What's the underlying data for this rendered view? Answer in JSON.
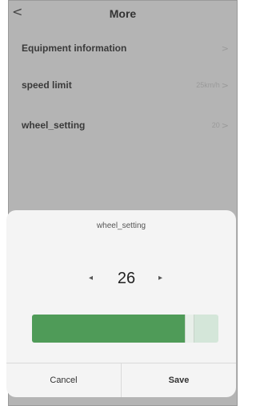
{
  "header": {
    "back_glyph": "<",
    "title": "More"
  },
  "rows": [
    {
      "label": "Equipment information",
      "value": "",
      "chevron": ">"
    },
    {
      "label": "speed limit",
      "value": "25km/h",
      "chevron": ">"
    },
    {
      "label": "wheel_setting",
      "value": "20",
      "chevron": ">"
    }
  ],
  "dialog": {
    "title": "wheel_setting",
    "decrease_glyph": "◂",
    "increase_glyph": "▸",
    "value": "26",
    "slider_level": 0.83,
    "cancel_label": "Cancel",
    "save_label": "Save"
  },
  "colors": {
    "screen_dim": "#b4b4b4",
    "sheet_bg": "#f4f4f4",
    "slider_fill": "#4f9b58",
    "slider_track": "#d4e6d9"
  }
}
